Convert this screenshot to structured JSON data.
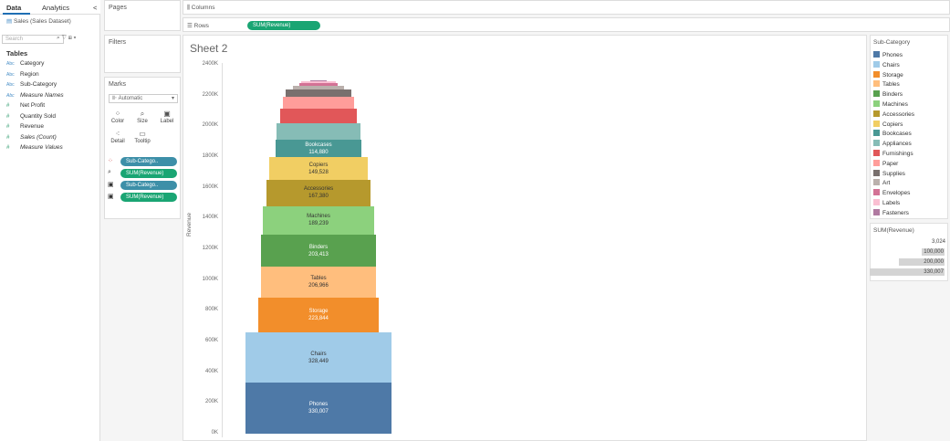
{
  "tabs": {
    "data": "Data",
    "analytics": "Analytics",
    "collapse": "<"
  },
  "datasource": "Sales (Sales Dataset)",
  "search": {
    "placeholder": "Search"
  },
  "tables_heading": "Tables",
  "fields": [
    {
      "type": "Abc",
      "name": "Category"
    },
    {
      "type": "Abc",
      "name": "Region"
    },
    {
      "type": "Abc",
      "name": "Sub-Category"
    },
    {
      "type": "Abc",
      "name": "Measure Names"
    },
    {
      "type": "#",
      "name": "Net Profit"
    },
    {
      "type": "#",
      "name": "Quantity Sold"
    },
    {
      "type": "#",
      "name": "Revenue"
    },
    {
      "type": "#",
      "name": "Sales (Count)"
    },
    {
      "type": "#",
      "name": "Measure Values"
    }
  ],
  "cards": {
    "pages": "Pages",
    "filters": "Filters",
    "marks": "Marks",
    "mark_type": "Automatic",
    "columns": "Columns",
    "rows": "Rows"
  },
  "mark_buttons": {
    "color": "Color",
    "size": "Size",
    "label": "Label",
    "detail": "Detail",
    "tooltip": "Tooltip"
  },
  "mark_pills": [
    "Sub-Catego..",
    "SUM(Revenue)",
    "Sub-Catego..",
    "SUM(Revenue)"
  ],
  "rows_pill": "SUM(Revenue)",
  "sheet_title": "Sheet 2",
  "colors": {
    "accent": "#1aa573",
    "pill_blue": "#3d8fa8"
  },
  "chart_data": {
    "type": "bar",
    "subtype": "funnel (stacked, centered)",
    "ylabel": "Revenue",
    "ylim": [
      0,
      2400000
    ],
    "yticks": [
      "0K",
      "200K",
      "400K",
      "600K",
      "800K",
      "1000K",
      "1200K",
      "1400K",
      "1600K",
      "1800K",
      "2000K",
      "2200K",
      "2400K"
    ],
    "categories": [
      "Phones",
      "Chairs",
      "Storage",
      "Tables",
      "Binders",
      "Machines",
      "Accessories",
      "Copiers",
      "Bookcases",
      "Appliances",
      "Furnishings",
      "Paper",
      "Supplies",
      "Art",
      "Envelopes",
      "Labels",
      "Fasteners"
    ],
    "values": [
      330007,
      328449,
      223844,
      206966,
      203413,
      189239,
      167380,
      149528,
      114880,
      107500,
      91700,
      78500,
      46700,
      27100,
      16400,
      12500,
      3024
    ],
    "labels": [
      "Phones\n330,007",
      "Chairs\n328,449",
      "Storage\n223,844",
      "Tables\n206,966",
      "Binders\n203,413",
      "Machines\n189,239",
      "Accessories\n167,380",
      "Copiers\n149,528",
      "Bookcases\n114,880",
      "",
      "",
      "",
      "",
      "",
      "",
      "",
      ""
    ],
    "colors": [
      "#4e79a7",
      "#a0cbe8",
      "#f28e2b",
      "#ffbe7d",
      "#59a14f",
      "#8cd17d",
      "#b6992d",
      "#f1ce63",
      "#499894",
      "#86bcb6",
      "#e15759",
      "#ff9d9a",
      "#79706e",
      "#bab0ac",
      "#d37295",
      "#fabfd2",
      "#b07aa1"
    ],
    "text_colors": [
      "#ffffff",
      "#333333",
      "#ffffff",
      "#333333",
      "#ffffff",
      "#333333",
      "#333333",
      "#333333",
      "#ffffff",
      "#333333",
      "#333333",
      "#333333",
      "#333333",
      "#333333",
      "#333333",
      "#333333",
      "#333333"
    ]
  },
  "legend": {
    "title": "Sub-Category"
  },
  "size_legend": {
    "title": "SUM(Revenue)",
    "values": [
      "3,024",
      "100,000",
      "200,000",
      "330,007"
    ],
    "fractions": [
      0.01,
      0.3,
      0.61,
      1.0
    ]
  }
}
